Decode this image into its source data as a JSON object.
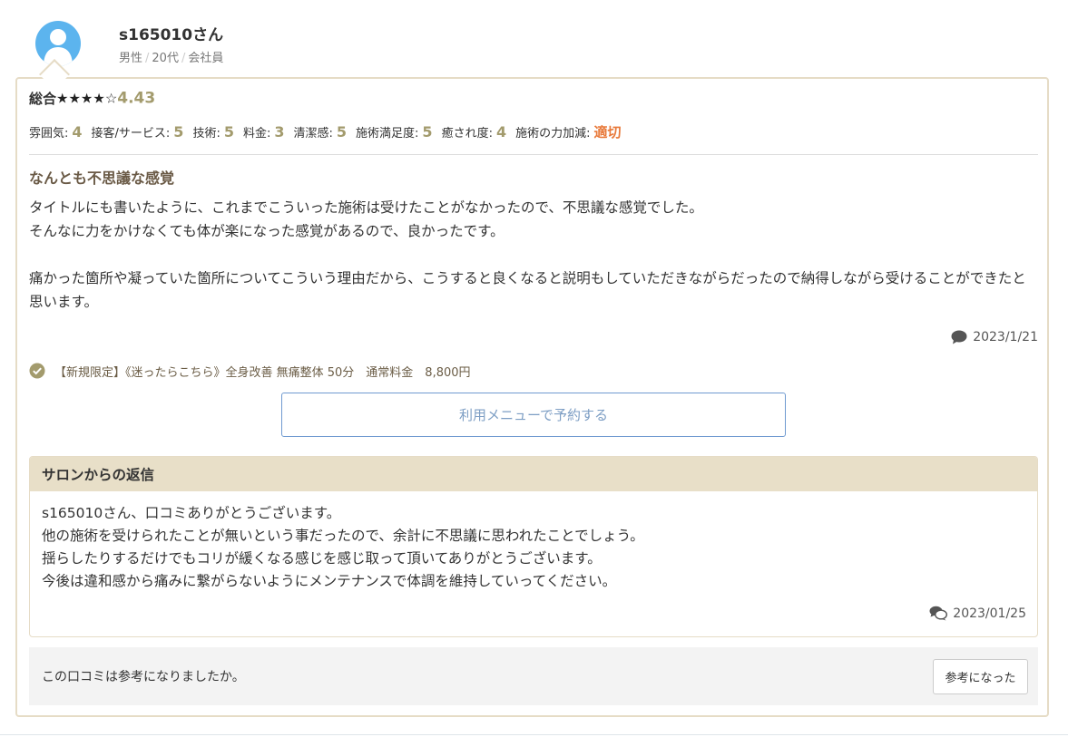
{
  "user": {
    "name": "s165010さん",
    "gender": "男性",
    "age": "20代",
    "job": "会社員",
    "avatar_color": "#5cb4ee"
  },
  "rating": {
    "label": "総合",
    "stars_filled": "★★★★",
    "stars_empty": "☆",
    "star_count": 4,
    "star_max": 5,
    "score": "4.43",
    "accent_color": "#a39b6d"
  },
  "scores": [
    {
      "label": "雰囲気:",
      "value": "4"
    },
    {
      "label": "接客/サービス:",
      "value": "5"
    },
    {
      "label": "技術:",
      "value": "5"
    },
    {
      "label": "料金:",
      "value": "3"
    },
    {
      "label": "清潔感:",
      "value": "5"
    },
    {
      "label": "施術満足度:",
      "value": "5"
    },
    {
      "label": "癒され度:",
      "value": "4"
    },
    {
      "label": "施術の力加減:",
      "value": "適切"
    }
  ],
  "review": {
    "title": "なんとも不思議な感覚",
    "paragraphs": [
      "タイトルにも書いたように、これまでこういった施術は受けたことがなかったので、不思議な感覚でした。\nそんなに力をかけなくても体が楽になった感覚があるので、良かったです。",
      "痛かった箇所や凝っていた箇所についてこういう理由だから、こうすると良くなると説明もしていただきながらだったので納得しながら受けることができたと思います。"
    ],
    "date": "2023/1/21",
    "date_icon": "speech-bubble-icon"
  },
  "menu": {
    "icon": "check-circle-icon",
    "text": "【新規限定】《迷ったらこちら》全身改善 無痛整体 50分　通常料金　8,800円",
    "book_label": "利用メニューで予約する"
  },
  "reply": {
    "header": "サロンからの返信",
    "lines": "s165010さん、口コミありがとうございます。\n他の施術を受けられたことが無いという事だったので、余計に不思議に思われたことでしょう。\n揺らしたりするだけでもコリが緩くなる感じを感じ取って頂いてありがとうございます。\n今後は違和感から痛みに繋がらないようにメンテナンスで体調を維持していってください。",
    "date": "2023/01/25",
    "date_icon": "double-speech-bubble-icon"
  },
  "helpful": {
    "question": "この口コミは参考になりましたか。",
    "button_label": "参考になった"
  }
}
